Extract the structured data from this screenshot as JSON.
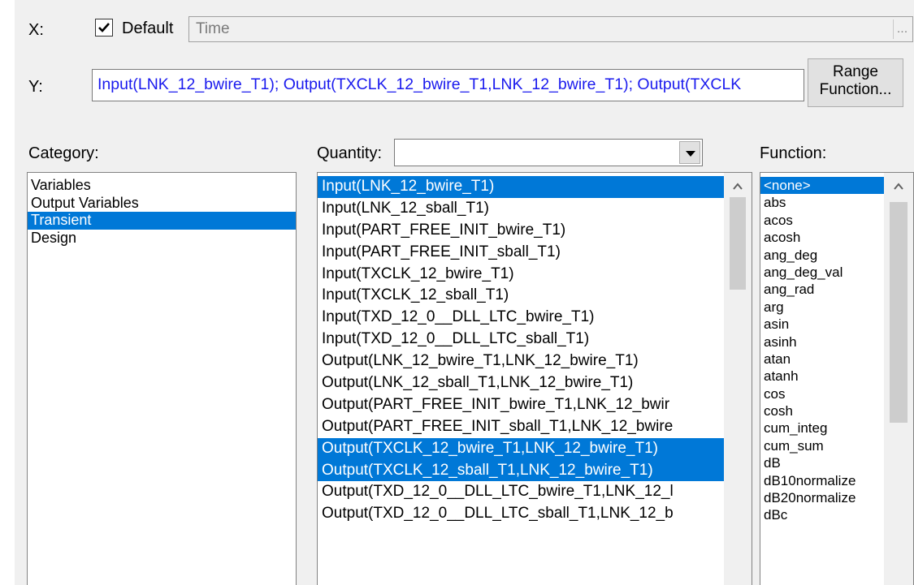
{
  "x_row": {
    "label": "X:",
    "default_checked": true,
    "default_label": "Default",
    "value": "Time",
    "browse_label": "..."
  },
  "y_row": {
    "label": "Y:",
    "value": "Input(LNK_12_bwire_T1); Output(TXCLK_12_bwire_T1,LNK_12_bwire_T1); Output(TXCLK",
    "range_function_line1": "Range",
    "range_function_line2": "Function..."
  },
  "category": {
    "label": "Category:",
    "items": [
      "Variables",
      "Output Variables",
      "Transient",
      "Design"
    ],
    "selected_index": 2
  },
  "quantity": {
    "label": "Quantity:",
    "filter_value": "",
    "items": [
      "Input(LNK_12_bwire_T1)",
      "Input(LNK_12_sball_T1)",
      "Input(PART_FREE_INIT_bwire_T1)",
      "Input(PART_FREE_INIT_sball_T1)",
      "Input(TXCLK_12_bwire_T1)",
      "Input(TXCLK_12_sball_T1)",
      "Input(TXD_12_0__DLL_LTC_bwire_T1)",
      "Input(TXD_12_0__DLL_LTC_sball_T1)",
      "Output(LNK_12_bwire_T1,LNK_12_bwire_T1)",
      "Output(LNK_12_sball_T1,LNK_12_bwire_T1)",
      "Output(PART_FREE_INIT_bwire_T1,LNK_12_bwir",
      "Output(PART_FREE_INIT_sball_T1,LNK_12_bwire",
      "Output(TXCLK_12_bwire_T1,LNK_12_bwire_T1)",
      "Output(TXCLK_12_sball_T1,LNK_12_bwire_T1)",
      "Output(TXD_12_0__DLL_LTC_bwire_T1,LNK_12_l",
      "Output(TXD_12_0__DLL_LTC_sball_T1,LNK_12_b"
    ],
    "selected_indices": [
      0,
      12,
      13
    ]
  },
  "function": {
    "label": "Function:",
    "items": [
      "<none>",
      "abs",
      "acos",
      "acosh",
      "ang_deg",
      "ang_deg_val",
      "ang_rad",
      "arg",
      "asin",
      "asinh",
      "atan",
      "atanh",
      "cos",
      "cosh",
      "cum_integ",
      "cum_sum",
      "dB",
      "dB10normalize",
      "dB20normalize",
      "dBc"
    ],
    "selected_index": 0
  },
  "icons": {
    "scroll_up": "chevron-up-icon",
    "dropdown": "triangle-down-icon",
    "check": "checkmark-icon"
  },
  "colors": {
    "selection": "#0078d7",
    "y_text": "#1a1aee",
    "panel": "#f0f0f0"
  }
}
